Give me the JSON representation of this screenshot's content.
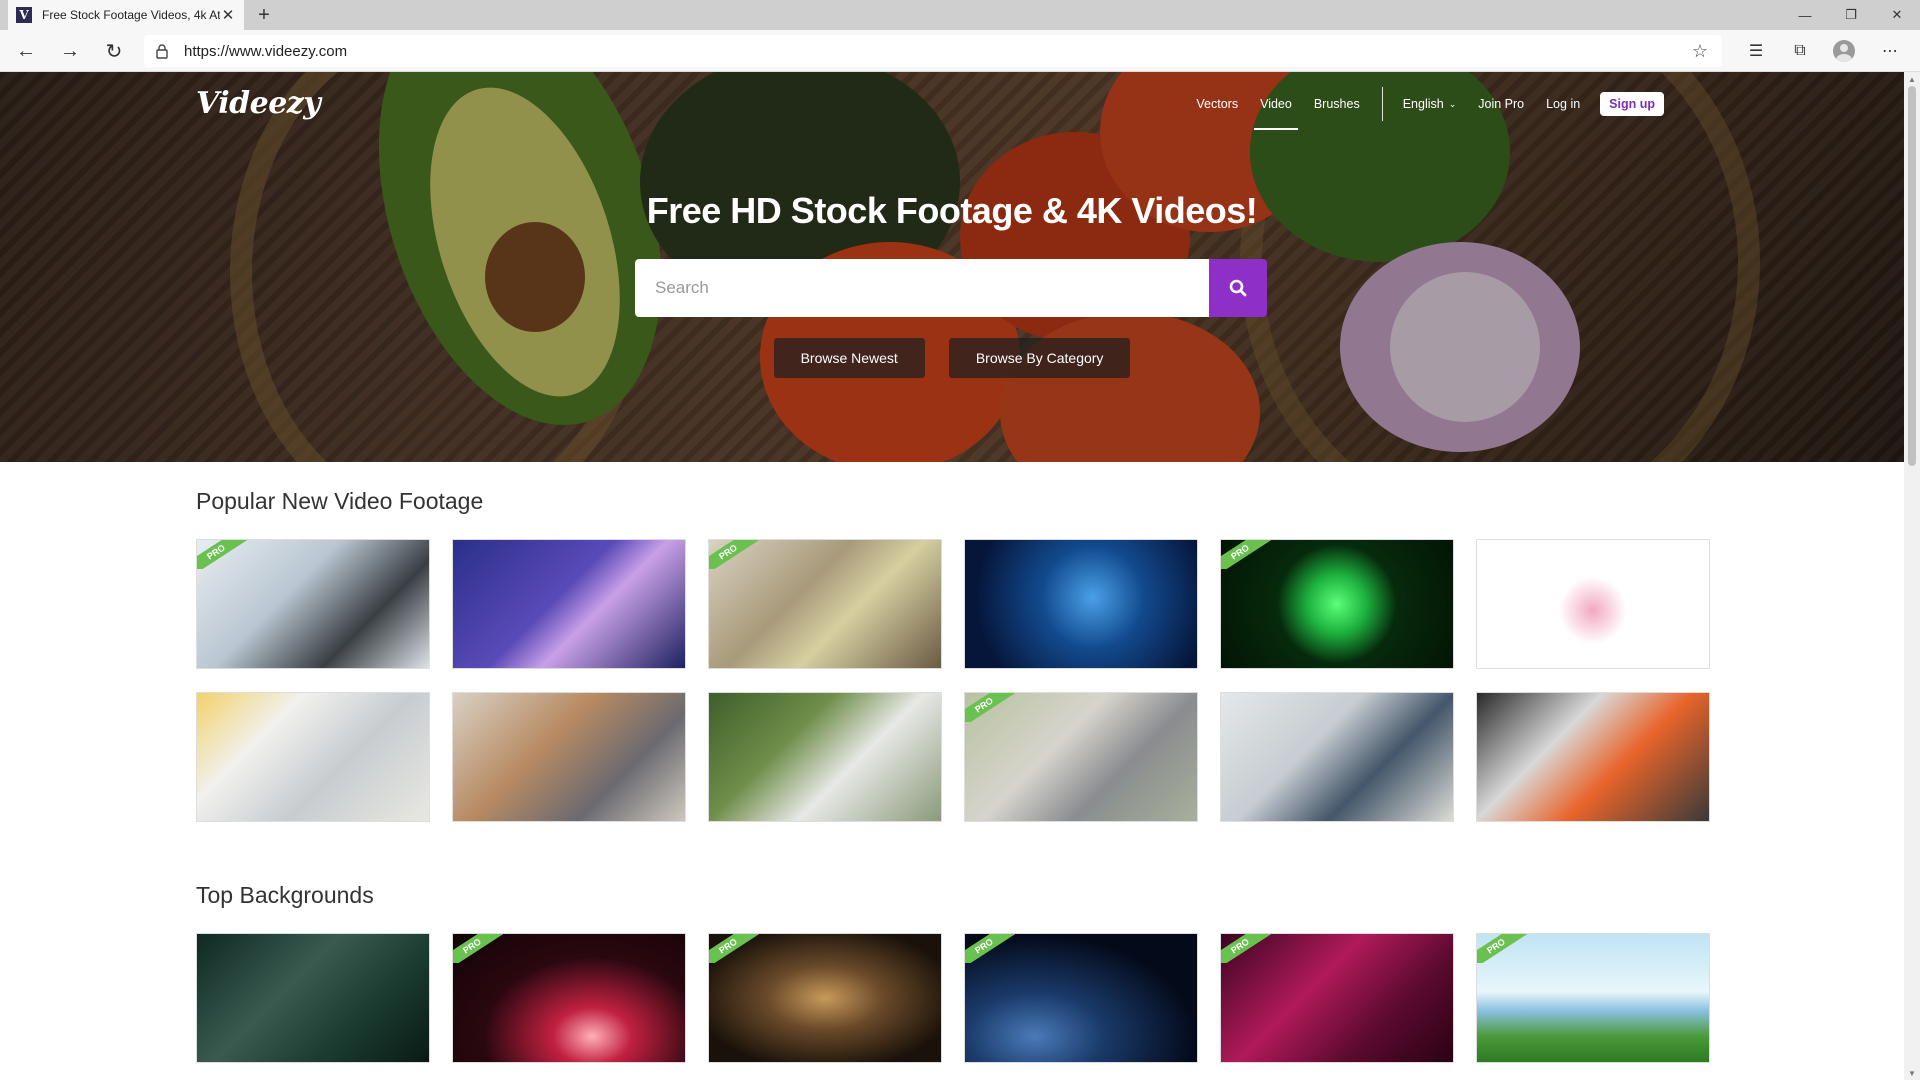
{
  "browser": {
    "tab_title": "Free Stock Footage Videos, 4k At",
    "tab_favicon_letter": "V",
    "url": "https://www.videezy.com"
  },
  "site": {
    "logo": "Videezy",
    "nav": {
      "vectors": "Vectors",
      "video": "Video",
      "brushes": "Brushes",
      "language": "English",
      "join_pro": "Join Pro",
      "login": "Log in",
      "signup": "Sign up"
    },
    "hero": {
      "title": "Free HD Stock Footage & 4K Videos!",
      "search_placeholder": "Search",
      "browse_newest": "Browse Newest",
      "browse_category": "Browse By Category"
    },
    "sections": {
      "popular_title": "Popular New Video Footage",
      "backgrounds_title": "Top Backgrounds"
    },
    "badge": "PRO",
    "colors": {
      "accent_purple": "#8e2fc7",
      "pro_green": "#6ac150"
    }
  }
}
